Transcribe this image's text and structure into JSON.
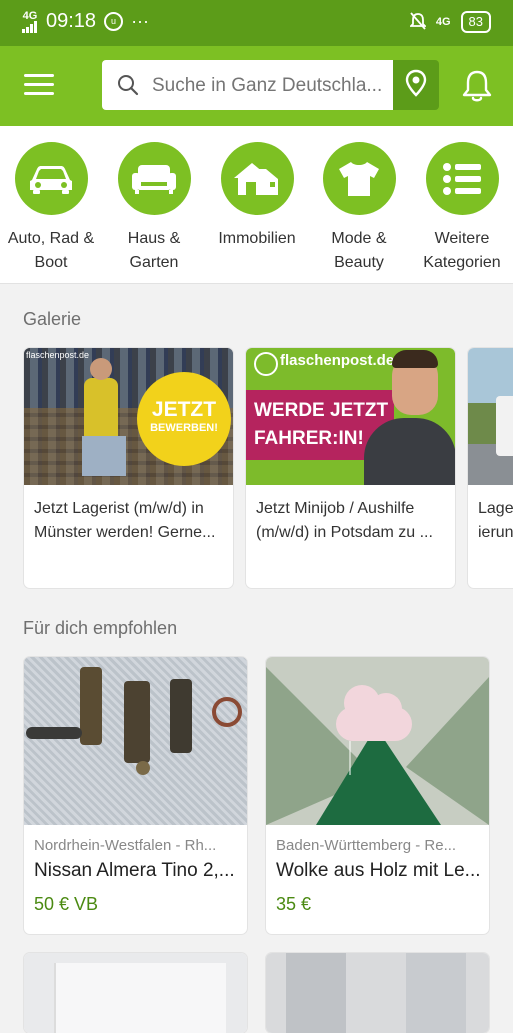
{
  "status_bar": {
    "network": "4G",
    "time": "09:18",
    "more": "···",
    "network_right": "4G",
    "battery": "83"
  },
  "header": {
    "search_placeholder": "Suche in Ganz Deutschla..."
  },
  "categories": [
    {
      "label": "Auto, Rad & Boot",
      "icon": "car-icon"
    },
    {
      "label": "Haus & Garten",
      "icon": "sofa-icon"
    },
    {
      "label": "Immobilien",
      "icon": "house-icon"
    },
    {
      "label": "Mode & Beauty",
      "icon": "tshirt-icon"
    },
    {
      "label": "Weitere Kategorien",
      "icon": "list-icon"
    }
  ],
  "gallery": {
    "title": "Galerie",
    "items": [
      {
        "text": "Jetzt Lagerist (m/w/d) in Münster werden! Gerne...",
        "badge": "JETZT",
        "badge_sub": "BEWERBEN!",
        "brand": "flaschenpost.de"
      },
      {
        "text": "Jetzt Minijob / Aushilfe (m/w/d) in Potsdam zu ...",
        "brand": "flaschenpost.de",
        "headline_1": "WERDE JETZT",
        "headline_2": "FAHRER:IN!"
      },
      {
        "text": "Lage ierun"
      }
    ]
  },
  "recommended": {
    "title": "Für dich empfohlen",
    "items": [
      {
        "location": "Nordrhein-Westfalen - Rh...",
        "title": "Nissan Almera Tino  2,...",
        "price": "50 € VB"
      },
      {
        "location": "Baden-Württemberg - Re...",
        "title": "Wolke aus Holz mit Le...",
        "price": "35 €"
      }
    ]
  },
  "colors": {
    "status_bar": "#5c9c19",
    "brand_green": "#7dc023",
    "price_green": "#4b8a12"
  }
}
